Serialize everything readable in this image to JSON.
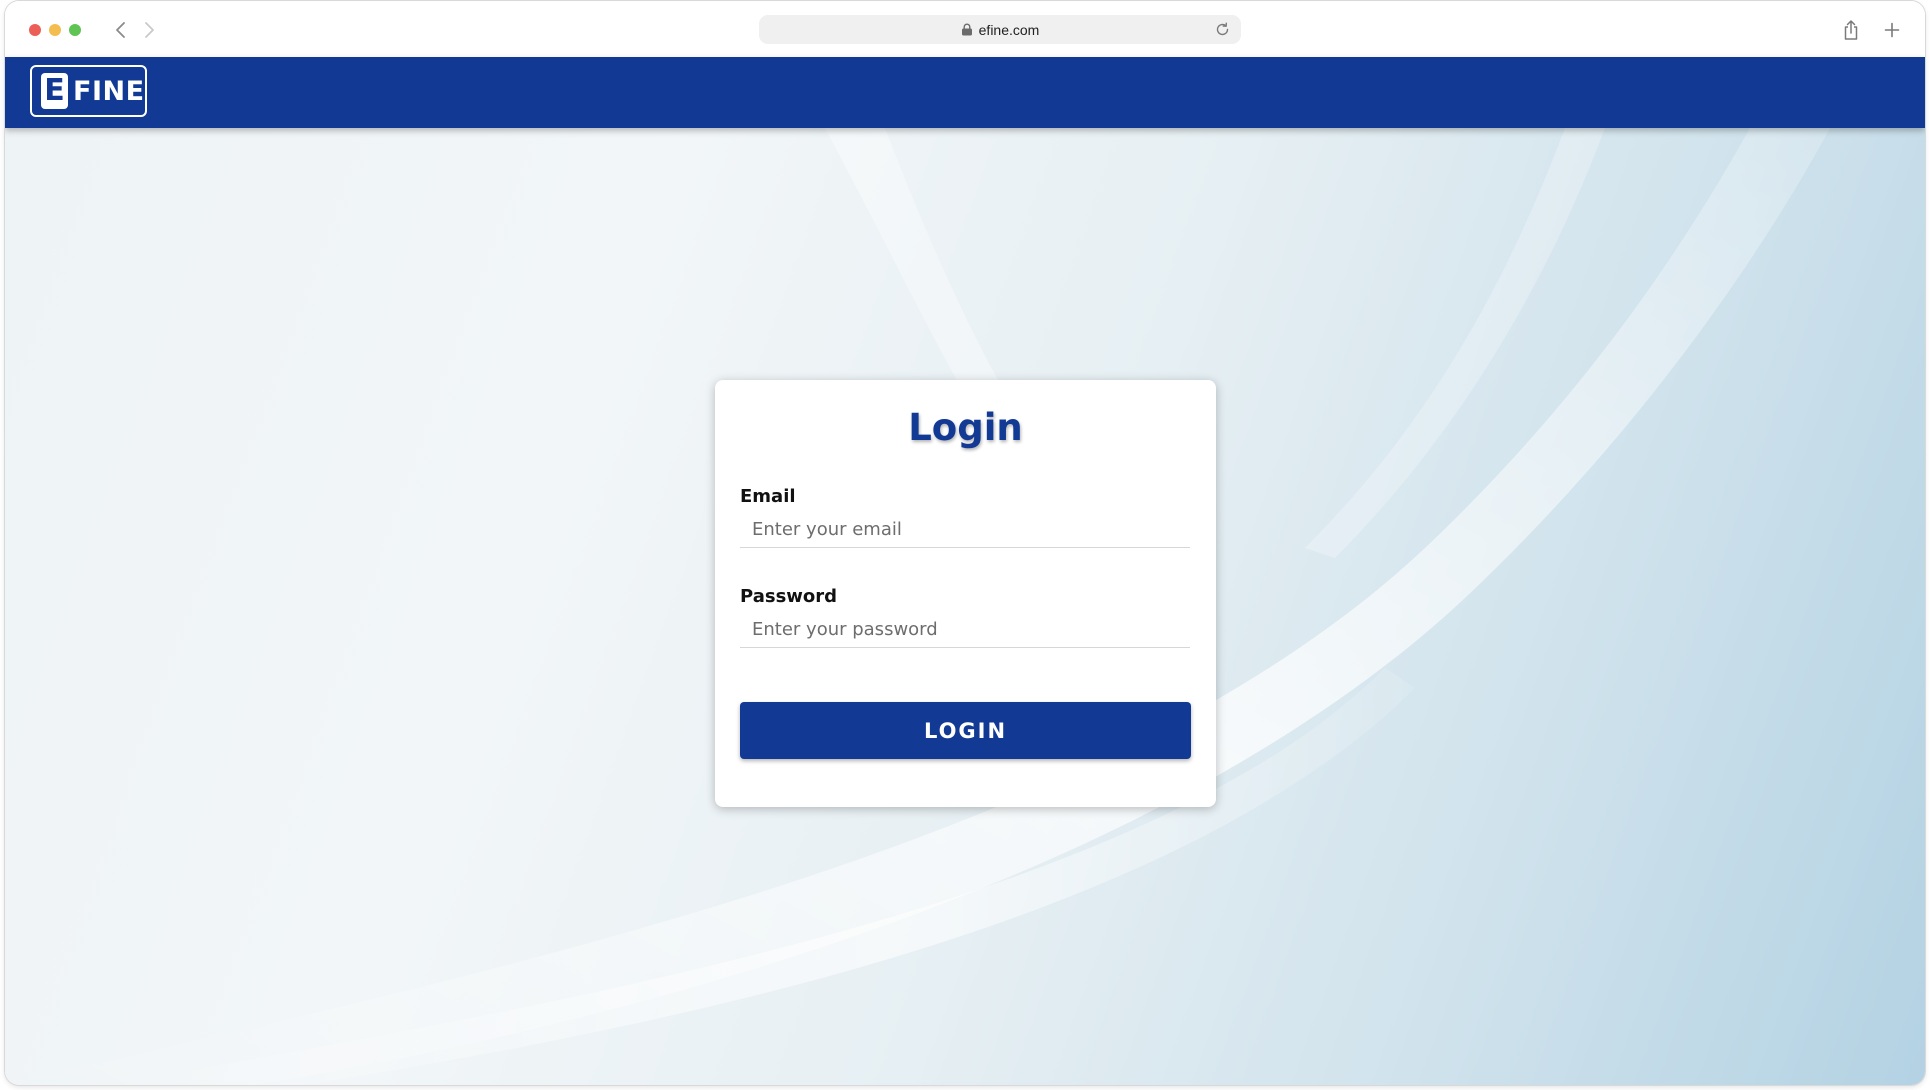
{
  "browser": {
    "url": "efine.com",
    "icons": {
      "close": "traffic-light-close",
      "minimize": "traffic-light-minimize",
      "maximize": "traffic-light-maximize",
      "back": "chevron-left-icon",
      "forward": "chevron-right-icon",
      "lock": "lock-icon",
      "reload": "reload-icon",
      "share": "share-icon",
      "new_tab": "plus-icon"
    }
  },
  "header": {
    "logo_mark": "E",
    "logo_text": "FINE",
    "color": "#123a94"
  },
  "login": {
    "title": "Login",
    "email": {
      "label": "Email",
      "placeholder": "Enter your email",
      "value": ""
    },
    "password": {
      "label": "Password",
      "placeholder": "Enter your password",
      "value": ""
    },
    "submit_label": "LOGIN"
  },
  "colors": {
    "brand": "#123a94",
    "card_bg": "#ffffff"
  }
}
